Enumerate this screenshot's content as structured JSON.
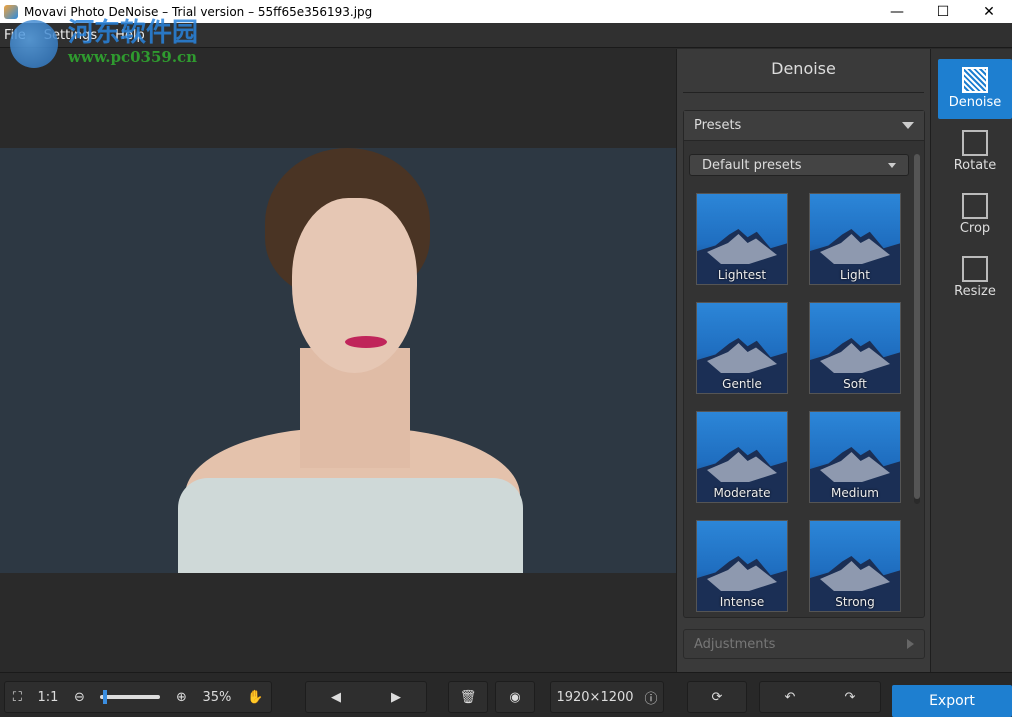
{
  "window": {
    "title": "Movavi Photo DeNoise – Trial version – 55ff65e356193.jpg",
    "minimize": "—",
    "maximize": "☐",
    "close": "✕"
  },
  "menu": [
    "File",
    "Settings",
    "Help"
  ],
  "watermark": {
    "cn": "河东软件园",
    "url": "www.pc0359.cn"
  },
  "panel": {
    "title": "Denoise",
    "presets_label": "Presets",
    "preset_dropdown": "Default presets",
    "presets": [
      "Lightest",
      "Light",
      "Gentle",
      "Soft",
      "Moderate",
      "Medium",
      "Intense",
      "Strong"
    ],
    "adjustments_label": "Adjustments"
  },
  "tools": [
    {
      "label": "Denoise",
      "icon": "denoise-icon",
      "active": true
    },
    {
      "label": "Rotate",
      "icon": "rotate-icon"
    },
    {
      "label": "Crop",
      "icon": "crop-icon"
    },
    {
      "label": "Resize",
      "icon": "resize-icon"
    }
  ],
  "bottom": {
    "fit": "⛶",
    "one_to_one": "1:1",
    "zoom_out": "⊖",
    "zoom_in": "⊕",
    "zoom": "35%",
    "zoom_fraction": 0.05,
    "hand": "✋",
    "prev": "◀",
    "next": "▶",
    "delete": "🗑",
    "preview": "◉",
    "dimensions": "1920×1200",
    "info": "ⓘ",
    "reset": "⟳",
    "undo": "↶",
    "redo": "↷",
    "export": "Export"
  },
  "colors": {
    "accent": "#1e7fd0"
  }
}
